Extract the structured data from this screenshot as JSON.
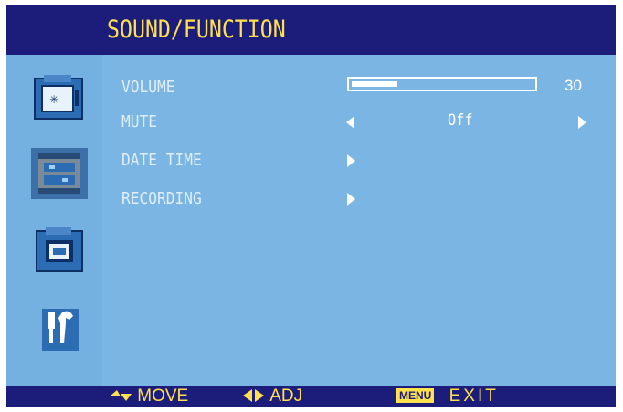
{
  "title": "SOUND/FUNCTION",
  "sidebar": {
    "icons": [
      {
        "name": "tv-picture-icon",
        "selected": false
      },
      {
        "name": "film-sound-function-icon",
        "selected": true
      },
      {
        "name": "screen-frame-icon",
        "selected": false
      },
      {
        "name": "tools-setup-icon",
        "selected": false
      }
    ]
  },
  "menu": {
    "volume": {
      "label": "VOLUME",
      "value": "30",
      "level_percent": 25
    },
    "mute": {
      "label": "MUTE",
      "value": "Off"
    },
    "date_time": {
      "label": "DATE TIME"
    },
    "recording": {
      "label": "RECORDING"
    }
  },
  "footer": {
    "move_label": "MOVE",
    "adj_label": "ADJ",
    "menu_key": "MENU",
    "exit_label": "EXIT"
  },
  "colors": {
    "panel_background": "#7bb5e3",
    "bar_background": "#1c1c7a",
    "title_text": "#ffe04d",
    "menu_text": "#dfeefa"
  }
}
